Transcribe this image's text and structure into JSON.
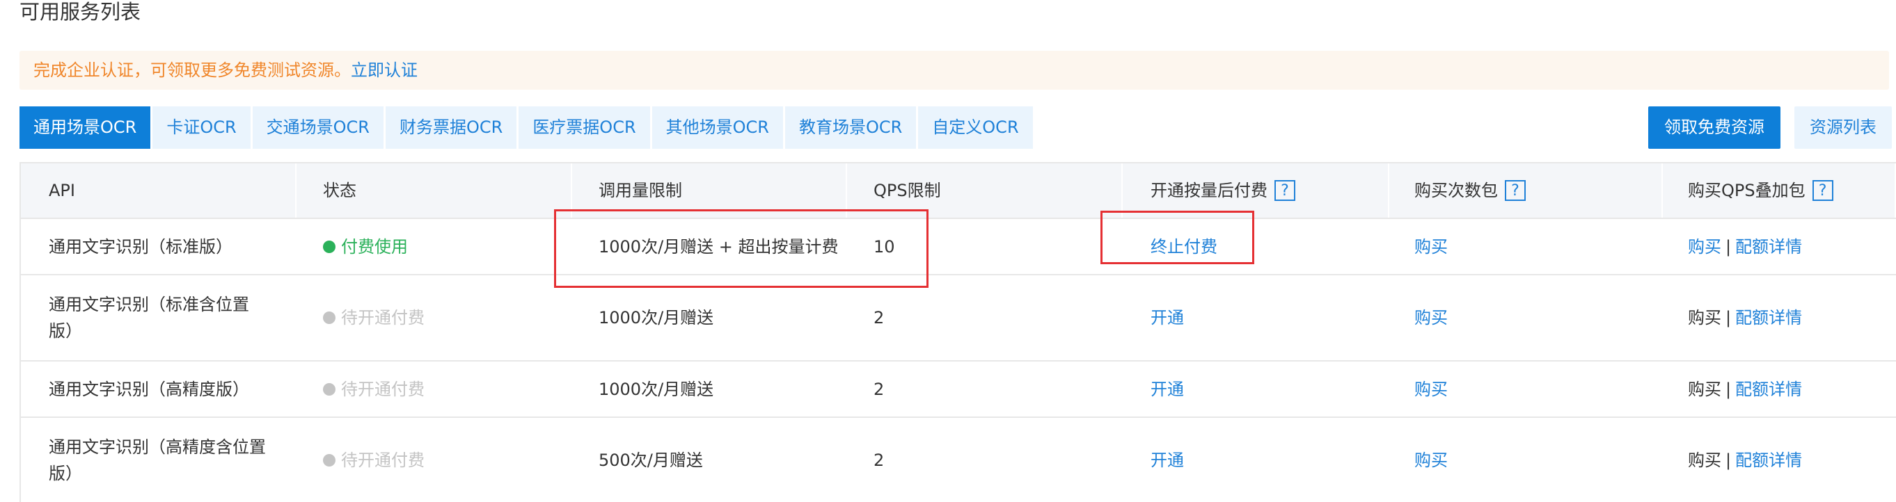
{
  "page_title": "可用服务列表",
  "notice": {
    "text": "完成企业认证，可领取更多免费测试资源。",
    "link": "立即认证"
  },
  "tabs": [
    {
      "label": "通用场景OCR",
      "active": true
    },
    {
      "label": "卡证OCR",
      "active": false
    },
    {
      "label": "交通场景OCR",
      "active": false
    },
    {
      "label": "财务票据OCR",
      "active": false
    },
    {
      "label": "医疗票据OCR",
      "active": false
    },
    {
      "label": "其他场景OCR",
      "active": false
    },
    {
      "label": "教育场景OCR",
      "active": false
    },
    {
      "label": "自定义OCR",
      "active": false
    }
  ],
  "buttons": {
    "free_resources": "领取免费资源",
    "resource_list": "资源列表"
  },
  "table": {
    "headers": [
      "API",
      "状态",
      "调用量限制",
      "QPS限制",
      "开通按量后付费",
      "购买次数包",
      "购买QPS叠加包"
    ],
    "help_mark": "?",
    "separator": "|",
    "rows": [
      {
        "api": "通用文字识别（标准版）",
        "status": "付费使用",
        "limit": "1000次/月赠送 + 超出按量计费",
        "qps": "10",
        "payg": "终止付费",
        "buy_count": "购买",
        "buy_qps": "购买",
        "quota": "配额详情"
      },
      {
        "api": "通用文字识别（标准含位置版）",
        "status": "待开通付费",
        "limit": "1000次/月赠送",
        "qps": "2",
        "payg": "开通",
        "buy_count": "购买",
        "buy_qps": "购买",
        "quota": "配额详情"
      },
      {
        "api": "通用文字识别（高精度版）",
        "status": "待开通付费",
        "limit": "1000次/月赠送",
        "qps": "2",
        "payg": "开通",
        "buy_count": "购买",
        "buy_qps": "购买",
        "quota": "配额详情"
      },
      {
        "api": "通用文字识别（高精度含位置版）",
        "status": "待开通付费",
        "limit": "500次/月赠送",
        "qps": "2",
        "payg": "开通",
        "buy_count": "购买",
        "buy_qps": "购买",
        "quota": "配额详情"
      }
    ]
  },
  "colors": {
    "primary": "#0e7fd9",
    "link": "#1f81d8",
    "warning": "#f0862a",
    "success": "#2bb15a",
    "muted": "#c4c4c4",
    "highlight": "#e53033"
  }
}
